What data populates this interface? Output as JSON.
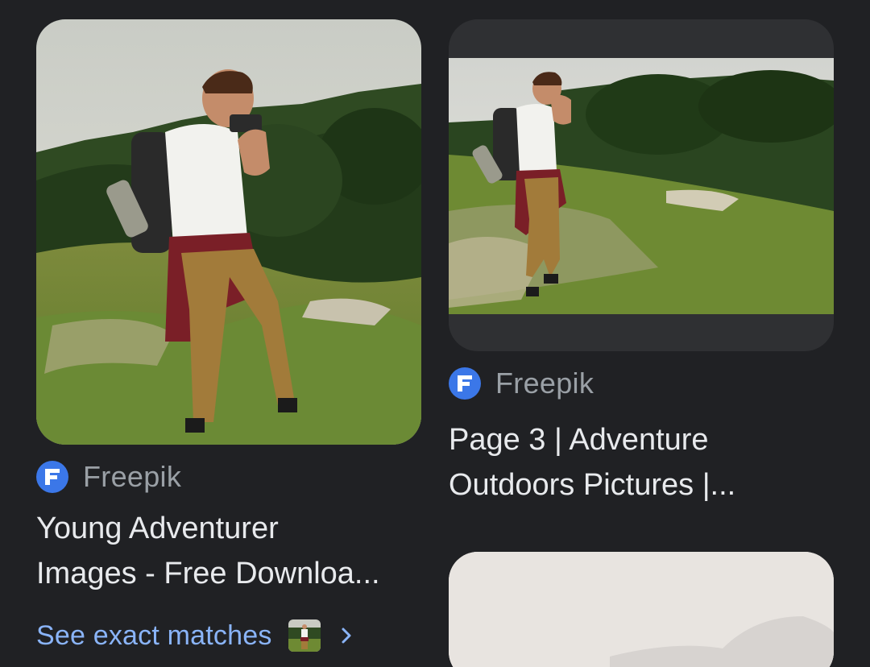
{
  "results": [
    {
      "source": "Freepik",
      "title": "Young Adventurer\nImages - Free Downloa...",
      "favicon_letter": "F"
    },
    {
      "source": "Freepik",
      "title": "Page 3 | Adventure\nOutdoors Pictures |...",
      "favicon_letter": "F"
    }
  ],
  "see_exact_matches": {
    "label": "See exact matches"
  },
  "colors": {
    "background": "#202124",
    "link": "#8ab4f8",
    "favicon": "#3b77e8",
    "source_text": "#9aa0a6",
    "title_text": "#e8eaed"
  }
}
